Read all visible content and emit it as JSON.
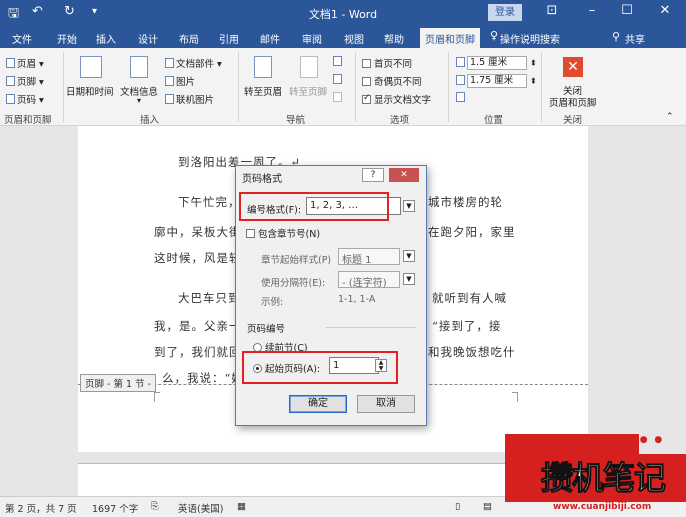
{
  "titlebar": {
    "title": "文档1 - Word",
    "login": "登录",
    "save_icon": "floppy-icon",
    "undo_icon": "undo-icon",
    "redo_icon": "redo-icon"
  },
  "tabs": {
    "items": [
      "文件",
      "开始",
      "插入",
      "设计",
      "布局",
      "引用",
      "邮件",
      "审阅",
      "视图",
      "帮助",
      "页眉和页脚"
    ],
    "active": "页眉和页脚",
    "search_hint": "操作说明搜索",
    "share": "共享"
  },
  "ribbon": {
    "hf_group": {
      "header": "页眉",
      "footer": "页脚",
      "page_number": "页码",
      "label": "页眉和页脚"
    },
    "insert_group": {
      "datetime": "日期和时间",
      "docinfo": "文档信息",
      "quickparts": "文档部件",
      "picture": "图片",
      "online_picture": "联机图片",
      "label": "插入"
    },
    "nav_group": {
      "goto_header": "转至页眉",
      "goto_footer": "转至页脚",
      "label": "导航"
    },
    "options_group": {
      "first_page": "首页不同",
      "odd_even": "奇偶页不同",
      "show_doc_text": "显示文档文字",
      "label": "选项"
    },
    "position_group": {
      "header_pos": "1.5 厘米",
      "footer_pos": "1.75 厘米",
      "label": "位置"
    },
    "close_group": {
      "close_line1": "关闭",
      "close_line2": "页眉和页脚",
      "label": "关闭"
    }
  },
  "document": {
    "lines": [
      "到洛阳出差一周了。↵",
      "下午忙完，",
      "城市楼房的轮",
      "廓中，呆板大街",
      "在跑夕阳，家里",
      "这时候，风是轻",
      "大巴车只到",
      "就听到有人喊",
      "我，是。父亲一",
      "“接到了，接",
      "到了，我们就回",
      "和我晚饭想吃什",
      "么，我说：“妈"
    ],
    "footer_tag": "页脚 - 第 1 节 -"
  },
  "dialog": {
    "title": "页码格式",
    "help": "?",
    "close": "✕",
    "number_format_label": "编号格式(F):",
    "number_format_value": "1, 2, 3, …",
    "include_chapter": "包含章节号(N)",
    "chapter_start_label": "章节起始样式(P)",
    "chapter_start_value": "标题 1",
    "separator_label": "使用分隔符(E):",
    "separator_value": "- (连字符)",
    "example_label": "示例:",
    "example_value": "1-1, 1-A",
    "page_numbering_label": "页码编号",
    "continue_label": "续前节(C)",
    "start_at_label": "起始页码(A):",
    "start_at_value": "1",
    "ok": "确定",
    "cancel": "取消"
  },
  "statusbar": {
    "page": "第 2 页，共 7 页",
    "words": "1697 个字",
    "language": "英语(美国)"
  },
  "watermark": {
    "brand": "攒机笔记",
    "url": "www.cuanjibiji.com"
  }
}
